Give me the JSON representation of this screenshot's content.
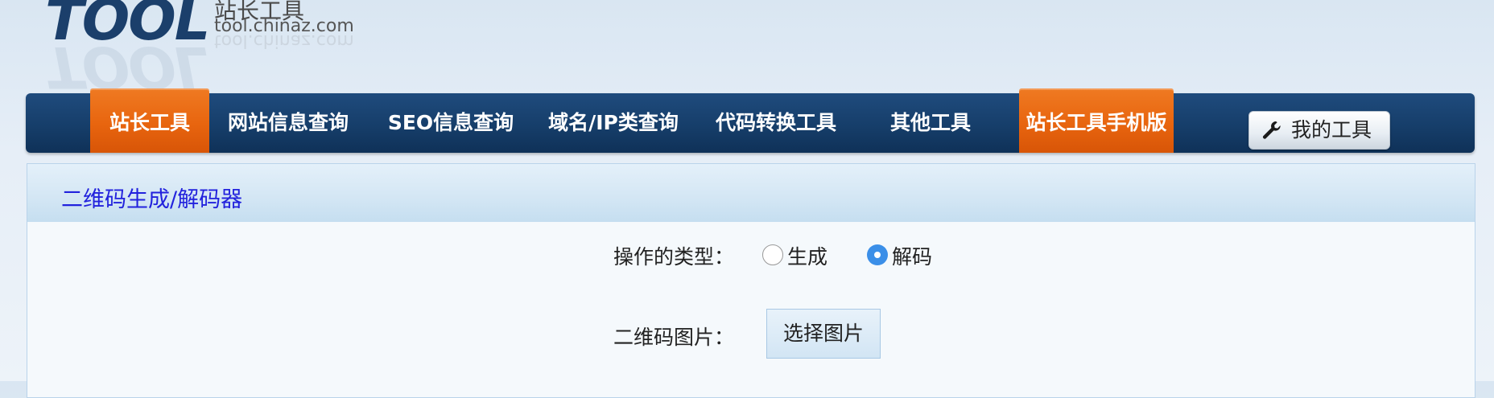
{
  "logo": {
    "wordmark": "TOOL",
    "cn_name": "站长工具",
    "domain": "tool.chinaz.com"
  },
  "nav": {
    "items": [
      {
        "label": "站长工具",
        "active": true
      },
      {
        "label": "网站信息查询",
        "active": false
      },
      {
        "label": "SEO信息查询",
        "active": false
      },
      {
        "label": "域名/IP类查询",
        "active": false
      },
      {
        "label": "代码转换工具",
        "active": false
      },
      {
        "label": "其他工具",
        "active": false
      },
      {
        "label": "站长工具手机版",
        "active": true
      }
    ],
    "my_tools": {
      "label": "我的工具",
      "icon": "wrench-icon"
    }
  },
  "panel": {
    "title": "二维码生成/解码器",
    "op_type_label": "操作的类型：",
    "options": [
      {
        "label": "生成",
        "checked": false
      },
      {
        "label": "解码",
        "checked": true
      }
    ],
    "image_label": "二维码图片：",
    "choose_button": "选择图片"
  },
  "colors": {
    "nav_bg": "#163e6a",
    "nav_active": "#e8650f",
    "title_color": "#2222dd",
    "radio_checked": "#3b8fe8"
  }
}
